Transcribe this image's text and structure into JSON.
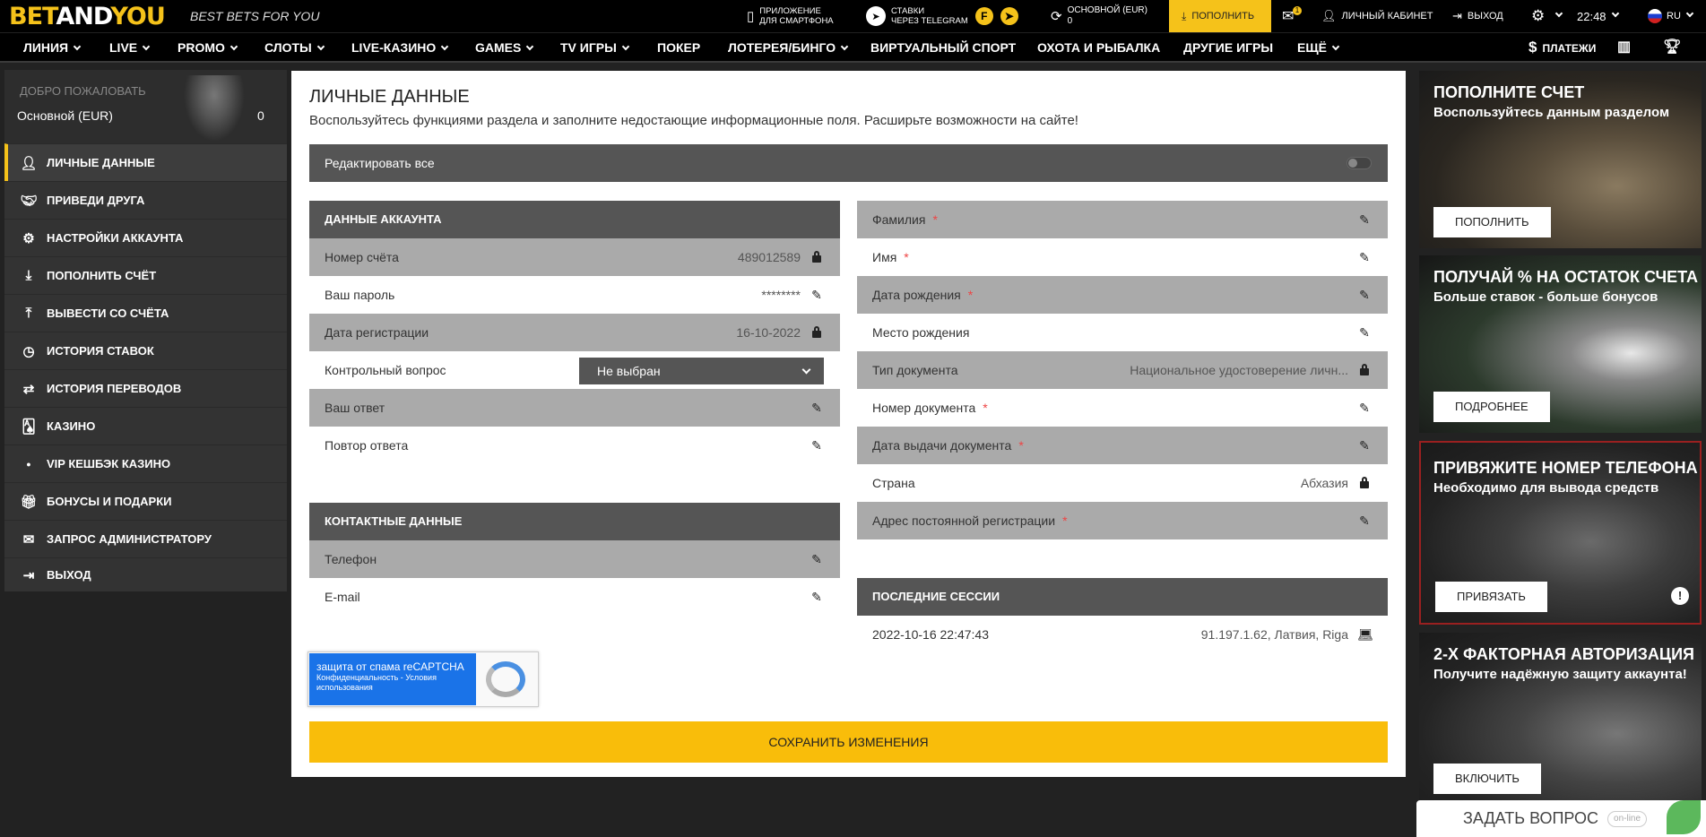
{
  "top": {
    "logo_a": "BET",
    "logo_b": "AND",
    "logo_c": "YOU",
    "tagline": "BEST BETS FOR YOU",
    "app_line1": "ПРИЛОЖЕНИЕ",
    "app_line2": "ДЛЯ СМАРТФОНА",
    "tg_line1": "СТАВКИ",
    "tg_line2": "ЧЕРЕЗ TELEGRAM",
    "account_label": "ОСНОВНОЙ (EUR)",
    "account_balance": "0",
    "deposit": "ПОПОЛНИТЬ",
    "mail_count": "1",
    "cabinet": "ЛИЧНЫЙ КАБИНЕТ",
    "logout": "ВЫХОД",
    "time": "22:48",
    "lang": "RU"
  },
  "nav": {
    "items": [
      {
        "label": "ЛИНИЯ"
      },
      {
        "label": "LIVE"
      },
      {
        "label": "PROMO"
      },
      {
        "label": "СЛОТЫ"
      },
      {
        "label": "LIVE-КАЗИНО"
      },
      {
        "label": "GAMES"
      },
      {
        "label": "TV ИГРЫ"
      },
      {
        "label": "ПОКЕР"
      },
      {
        "label": "ЛОТЕРЕЯ/БИНГО"
      },
      {
        "label": "ВИРТУАЛЬНЫЙ СПОРТ"
      },
      {
        "label": "ОХОТА И РЫБАЛКА"
      },
      {
        "label": "ДРУГИЕ ИГРЫ"
      },
      {
        "label": "ЕЩЁ"
      }
    ],
    "payments": "ПЛАТЕЖИ"
  },
  "sidebar": {
    "hello": "ДОБРО ПОЖАЛОВАТЬ",
    "account": "Основной (EUR)",
    "balance": "0",
    "items": [
      {
        "label": "ЛИЧНЫЕ ДАННЫЕ"
      },
      {
        "label": "ПРИВЕДИ ДРУГА"
      },
      {
        "label": "НАСТРОЙКИ АККАУНТА"
      },
      {
        "label": "ПОПОЛНИТЬ СЧЁТ"
      },
      {
        "label": "ВЫВЕСТИ СО СЧЁТА"
      },
      {
        "label": "ИСТОРИЯ СТАВОК"
      },
      {
        "label": "ИСТОРИЯ ПЕРЕВОДОВ"
      },
      {
        "label": "КАЗИНО"
      },
      {
        "label": "VIP КЕШБЭК КАЗИНО"
      },
      {
        "label": "БОНУСЫ И ПОДАРКИ"
      },
      {
        "label": "ЗАПРОС АДМИНИСТРАТОРУ"
      },
      {
        "label": "ВЫХОД"
      }
    ]
  },
  "main": {
    "title": "ЛИЧНЫЕ ДАННЫЕ",
    "subtitle": "Воспользуйтесь функциями раздела и заполните недостающие информационные поля. Расширьте возможности на сайте!",
    "edit_all": "Редактировать все",
    "account_section": {
      "title": "ДАННЫЕ АККАУНТА",
      "account_number_label": "Номер счёта",
      "account_number": "489012589",
      "password_label": "Ваш пароль",
      "password": "********",
      "reg_date_label": "Дата регистрации",
      "reg_date": "16-10-2022",
      "question_label": "Контрольный вопрос",
      "question_value": "Не выбран",
      "answer_label": "Ваш ответ",
      "repeat_label": "Повтор ответа"
    },
    "contact_section": {
      "title": "КОНТАКТНЫЕ ДАННЫЕ",
      "phone_label": "Телефон",
      "email_label": "E-mail"
    },
    "personal": {
      "surname": "Фамилия",
      "name": "Имя",
      "birth_date": "Дата рождения",
      "birth_place": "Место рождения",
      "doc_type": "Тип документа",
      "doc_type_value": "Национальное удостоверение личн...",
      "doc_number": "Номер документа",
      "doc_date": "Дата выдачи документа",
      "country": "Страна",
      "country_value": "Абхазия",
      "address": "Адрес постоянной регистрации",
      "required_mark": "*"
    },
    "sessions": {
      "title": "ПОСЛЕДНИЕ СЕССИИ",
      "date": "2022-10-16 22:47:43",
      "ip": "91.197.1.62, Латвия, Riga"
    },
    "captcha": {
      "line1": "защита от спама reCAPTCHA",
      "line2": "Конфиденциальность - Условия использования"
    },
    "save": "СОХРАНИТЬ ИЗМЕНЕНИЯ"
  },
  "promos": [
    {
      "title": "ПОПОЛНИТЕ СЧЕТ",
      "text": "Воспользуйтесь данным разделом",
      "button": "ПОПОЛНИТЬ"
    },
    {
      "title": "ПОЛУЧАЙ % НА ОСТАТОК СЧЕТА",
      "text": "Больше ставок - больше бонусов",
      "button": "ПОДРОБНЕЕ"
    },
    {
      "title": "ПРИВЯЖИТЕ НОМЕР ТЕЛЕФОНА",
      "text": "Необходимо для вывода средств",
      "button": "ПРИВЯЗАТЬ"
    },
    {
      "title": "2-Х ФАКТОРНАЯ АВТОРИЗАЦИЯ",
      "text": "Получите надёжную защиту аккаунта!",
      "button": "ВКЛЮЧИТЬ"
    }
  ],
  "chat": {
    "label": "ЗАДАТЬ ВОПРОС",
    "status": "on-line"
  }
}
